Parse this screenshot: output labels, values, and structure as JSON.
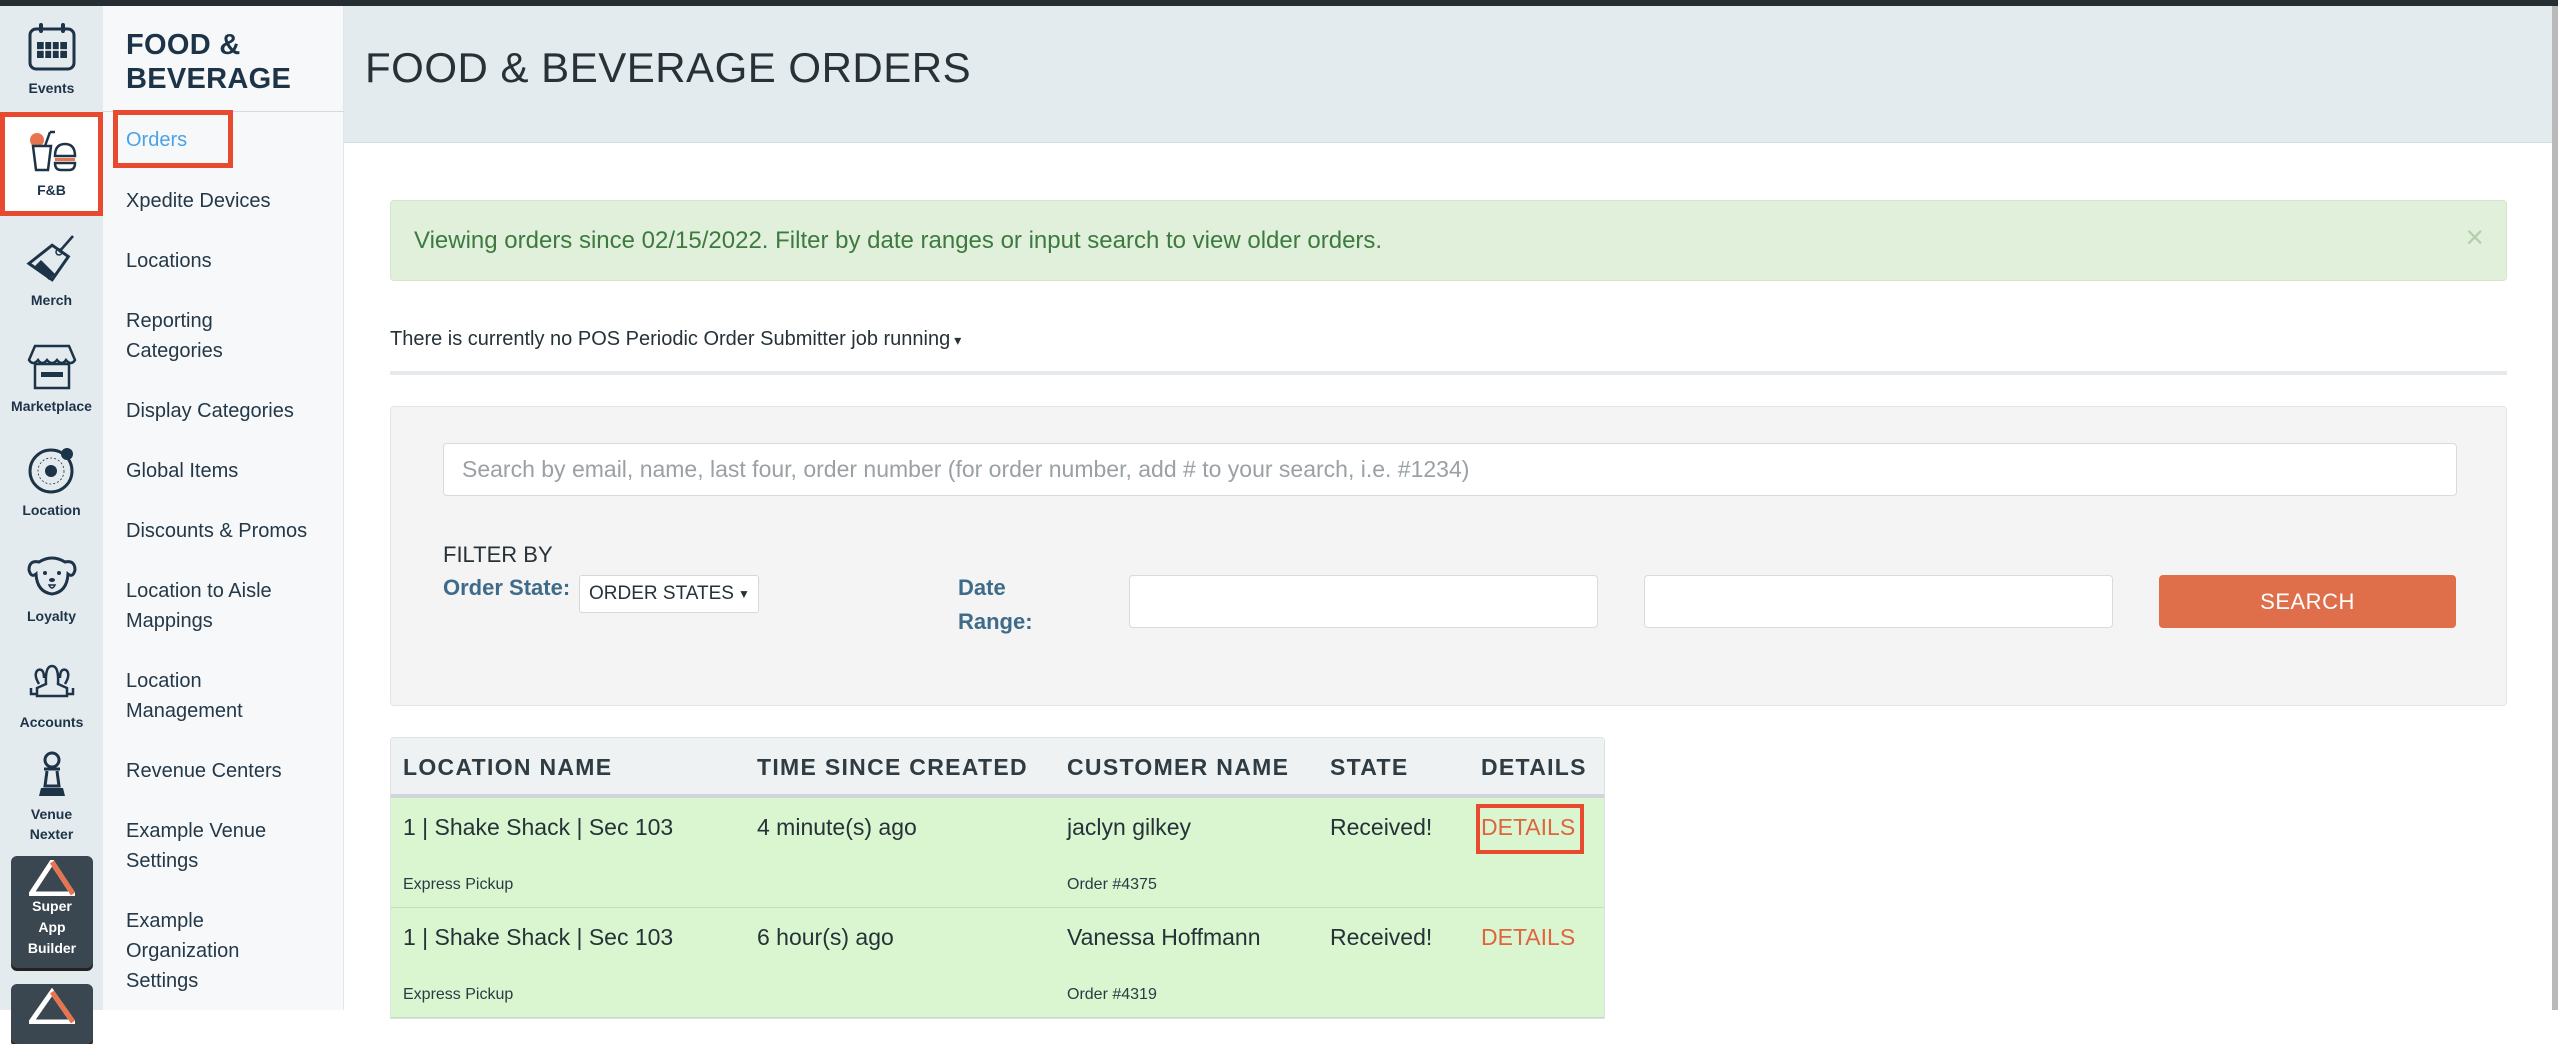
{
  "rail": {
    "items": [
      {
        "label": "Events",
        "icon": "calendar-icon"
      },
      {
        "label": "F&B",
        "icon": "food-beverage-icon",
        "active": true
      },
      {
        "label": "Merch",
        "icon": "tag-icon"
      },
      {
        "label": "Marketplace",
        "icon": "storefront-icon"
      },
      {
        "label": "Location",
        "icon": "location-target-icon"
      },
      {
        "label": "Loyalty",
        "icon": "dog-icon"
      },
      {
        "label": "Accounts",
        "icon": "users-icon"
      },
      {
        "label": "Venue Nexter",
        "label_lines": [
          "Venue",
          "Nexter"
        ],
        "icon": "pawn-icon"
      }
    ],
    "dark_items": [
      {
        "label_lines": [
          "Super",
          "App",
          "Builder"
        ],
        "icon": "triangle-logo-icon"
      },
      {
        "label_lines": [],
        "icon": "triangle-logo-icon"
      }
    ]
  },
  "sidebar": {
    "title_lines": [
      "FOOD &",
      "BEVERAGE"
    ],
    "items": [
      {
        "label": "Orders",
        "active": true
      },
      {
        "label": "Xpedite Devices"
      },
      {
        "label": "Locations"
      },
      {
        "label": "Reporting Categories"
      },
      {
        "label": "Display Categories"
      },
      {
        "label": "Global Items"
      },
      {
        "label": "Discounts & Promos"
      },
      {
        "label": "Location to Aisle Mappings"
      },
      {
        "label": "Location Management"
      },
      {
        "label": "Revenue Centers"
      },
      {
        "label": "Example Venue Settings"
      },
      {
        "label": "Example Organization Settings"
      }
    ]
  },
  "header": {
    "title": "FOOD & BEVERAGE ORDERS"
  },
  "alert": {
    "text": "Viewing orders since 02/15/2022. Filter by date ranges or input search to view older orders.",
    "close": "×"
  },
  "pos_status": {
    "text": "There is currently no POS Periodic Order Submitter job running",
    "caret": "▾"
  },
  "filters": {
    "search_placeholder": "Search by email, name, last four, order number (for order number, add # to your search, i.e. #1234)",
    "search_value": "",
    "filter_by": "FILTER BY",
    "order_state_label": "Order State:",
    "order_state_value": "ORDER STATES",
    "date_range_label": "Date Range:",
    "date_from": "",
    "date_to": "",
    "search_button": "SEARCH"
  },
  "table": {
    "columns": [
      "LOCATION NAME",
      "TIME SINCE CREATED",
      "CUSTOMER NAME",
      "STATE",
      "DETAILS"
    ],
    "rows": [
      {
        "location": "1 | Shake Shack | Sec 103",
        "location_sub": "Express Pickup",
        "time": "4 minute(s) ago",
        "customer": "jaclyn gilkey",
        "order": "Order #4375",
        "state": "Received!",
        "details": "DETAILS",
        "highlighted": true
      },
      {
        "location": "1 | Shake Shack | Sec 103",
        "location_sub": "Express Pickup",
        "time": "6 hour(s) ago",
        "customer": "Vanessa Hoffmann",
        "order": "Order #4319",
        "state": "Received!",
        "details": "DETAILS"
      }
    ]
  },
  "colors": {
    "accent_orange": "#df6e4a",
    "highlight_red": "#e84a2f",
    "active_link": "#4aa3e6",
    "row_green": "#d9f6d0",
    "alert_green": "#e1f0db"
  }
}
